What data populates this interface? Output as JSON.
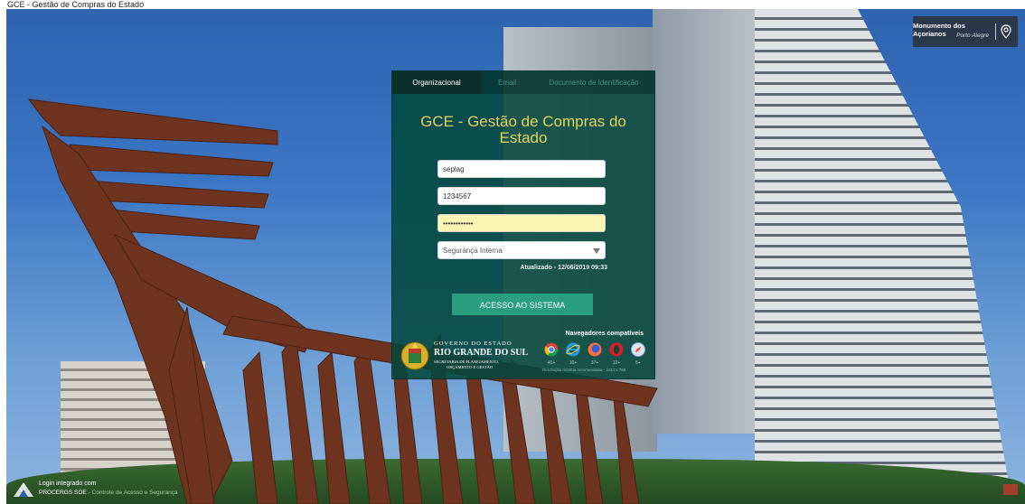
{
  "browser_caption": "GCE - Gestão de Compras do Estado",
  "location": {
    "title": "Monumento dos Açorianos",
    "subtitle": "Porto Alegre"
  },
  "footer": {
    "line1": "Login integrado com",
    "line2_brand": "PROCERGS SOE",
    "line2_rest": " - Controle de Acesso e Segurança"
  },
  "tabs": [
    {
      "label": "Organizacional",
      "active": true
    },
    {
      "label": "Email",
      "active": false
    },
    {
      "label": "Documento de Identificação",
      "active": false
    }
  ],
  "title": "GCE - Gestão de Compras do Estado",
  "form": {
    "org_value": "seplag",
    "user_value": "1234567",
    "password_value": "••••••••••••",
    "security_selected": "Segurança Interna",
    "updated": "Atualizado - 12/06/2019 09:33",
    "submit_label": "ACESSO AO SISTEMA"
  },
  "browsers": {
    "label": "Navegadores compatíveis",
    "items": [
      {
        "icon": "chrome-icon",
        "version": "41+"
      },
      {
        "icon": "ie-icon",
        "version": "10+"
      },
      {
        "icon": "firefox-icon",
        "version": "37+"
      },
      {
        "icon": "opera-icon",
        "version": "12+"
      },
      {
        "icon": "safari-icon",
        "version": "5+"
      }
    ],
    "note": "Resolução mínima recomendada - 1024 x 768"
  },
  "government": {
    "line1": "GOVERNO DO ESTADO",
    "line2": "RIO GRANDE DO SUL",
    "line3": "SECRETARIA DE PLANEJAMENTO,",
    "line4": "ORÇAMENTO E GESTÃO"
  },
  "colors": {
    "panel": "#05483e",
    "title": "#e6d35a",
    "button": "#2a9e7e",
    "password_bg": "#fbf6b4"
  }
}
